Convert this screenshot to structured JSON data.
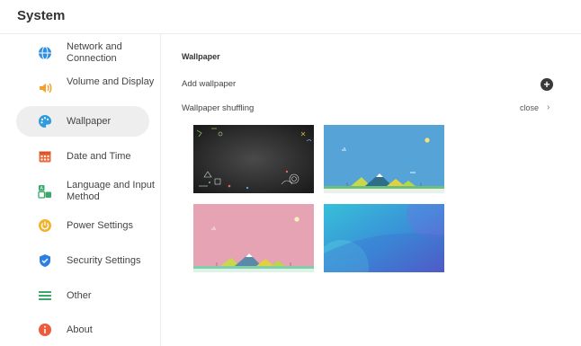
{
  "app": {
    "title": "System"
  },
  "sidebar": {
    "items": [
      {
        "label": "Network and Connection",
        "icon": "globe-icon",
        "color": "#2f8fe0"
      },
      {
        "label": "Volume and Display",
        "icon": "volume-icon",
        "color": "#f2a22a"
      },
      {
        "label": "Wallpaper",
        "icon": "palette-icon",
        "color": "#2f9be0",
        "selected": true
      },
      {
        "label": "Date and Time",
        "icon": "calendar-icon",
        "color": "#ee6a3a"
      },
      {
        "label": "Language and Input Method",
        "icon": "language-icon",
        "color": "#3aa86a"
      },
      {
        "label": "Power Settings",
        "icon": "power-icon",
        "color": "#f2b22a"
      },
      {
        "label": "Security Settings",
        "icon": "shield-icon",
        "color": "#2f7fe0"
      },
      {
        "label": "Other",
        "icon": "list-icon",
        "color": "#3aa86a"
      },
      {
        "label": "About",
        "icon": "info-icon",
        "color": "#ee5a3a"
      }
    ]
  },
  "main": {
    "section_title": "Wallpaper",
    "add_wallpaper_label": "Add wallpaper",
    "add_icon": "plus-circle-icon",
    "shuffling_label": "Wallpaper shuffling",
    "shuffling_value": "close",
    "chevron": "›",
    "wallpapers": [
      {
        "name": "dark-doodle",
        "selected": true
      },
      {
        "name": "blue-landscape"
      },
      {
        "name": "pink-landscape"
      },
      {
        "name": "blue-gradient"
      }
    ]
  },
  "colors": {
    "selected_bg": "#eeeeee",
    "divider": "#ececec",
    "add_button": "#3a3a3a"
  }
}
